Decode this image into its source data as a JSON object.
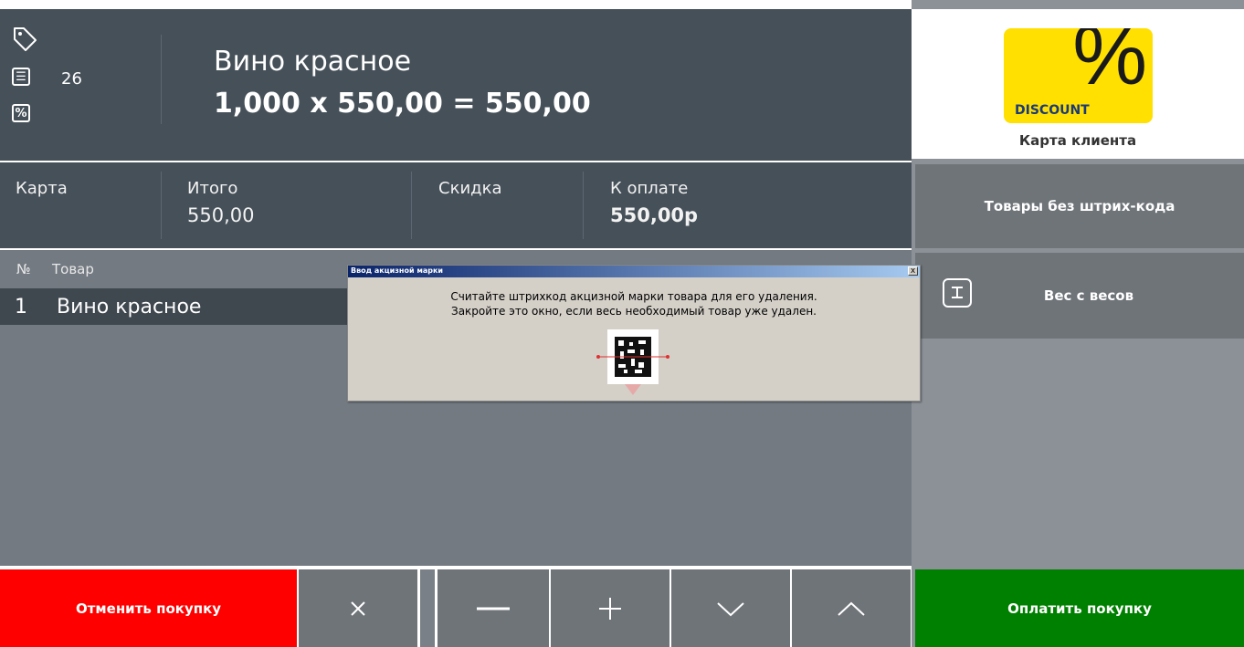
{
  "header": {
    "counter": "26",
    "product_name": "Вино красное",
    "product_calc": "1,000 x 550,00 = 550,00"
  },
  "summary": {
    "card_label": "Карта",
    "total_label": "Итого",
    "total_value": "550,00",
    "discount_label": "Скидка",
    "to_pay_label": "К оплате",
    "to_pay_value": "550,00р"
  },
  "list": {
    "col_num": "№",
    "col_item": "Товар",
    "rows": [
      {
        "num": "1",
        "name": "Вино красное"
      }
    ]
  },
  "right_panel": {
    "discount_word": "DISCOUNT",
    "discount_symbol": "%",
    "client_card_label": "Карта клиента",
    "no_barcode_label": "Товары без штрих-кода",
    "scale_label": "Вес с весов"
  },
  "bottom": {
    "cancel_label": "Отменить покупку",
    "pay_label": "Оплатить покупку",
    "delete_symbol": "✕",
    "minus_symbol": "—",
    "plus_symbol": "+",
    "down_symbol": "chevron-down",
    "up_symbol": "chevron-up"
  },
  "dialog": {
    "title": "Ввод акцизной марки",
    "close_symbol": "x",
    "line1": "Считайте штрихкод акцизной марки товара для его удаления.",
    "line2": "Закройте это окно, если весь необходимый товар уже удален."
  },
  "colors": {
    "cancel": "#ff0000",
    "pay": "#008000",
    "discount_logo": "#ffe000",
    "header_bg": "#465059"
  }
}
